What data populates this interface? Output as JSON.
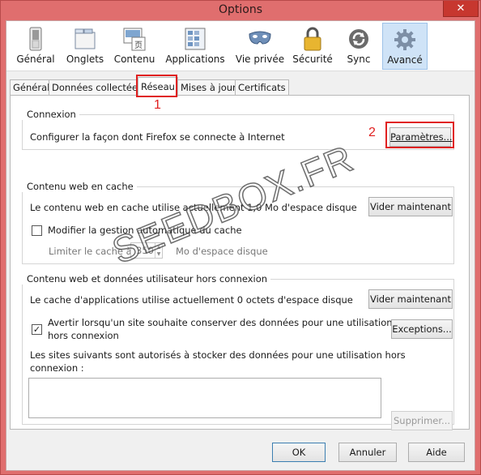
{
  "window": {
    "title": "Options",
    "close_glyph": "✕"
  },
  "panes": [
    {
      "label": "Général",
      "icon": "switch-icon"
    },
    {
      "label": "Onglets",
      "icon": "tabs-icon"
    },
    {
      "label": "Contenu",
      "icon": "content-icon"
    },
    {
      "label": "Applications",
      "icon": "applications-icon"
    },
    {
      "label": "Vie privée",
      "icon": "mask-icon"
    },
    {
      "label": "Sécurité",
      "icon": "padlock-icon"
    },
    {
      "label": "Sync",
      "icon": "sync-icon"
    },
    {
      "label": "Avancé",
      "icon": "gear-icon"
    }
  ],
  "selected_pane": "Avancé",
  "tabs": [
    "Général",
    "Données collectées",
    "Réseau",
    "Mises à jour",
    "Certificats"
  ],
  "active_tab": "Réseau",
  "connexion": {
    "title": "Connexion",
    "description": "Configurer la façon dont Firefox se connecte à Internet",
    "settings_button": "Paramètres..."
  },
  "cache": {
    "title": "Contenu web en cache",
    "usage_text": "Le contenu web en cache utilise actuellement 1,0 Mo d'espace disque",
    "clear_button": "Vider maintenant",
    "override_label": "Modifier la gestion automatique du cache",
    "override_checked": false,
    "limit_label": "Limiter le cache à",
    "limit_value": "350",
    "limit_unit": "Mo d'espace disque"
  },
  "offline": {
    "title": "Contenu web et données utilisateur hors connexion",
    "usage_text": "Le cache d'applications utilise actuellement 0 octets d'espace disque",
    "clear_button": "Vider maintenant",
    "warn_label_line1": "Avertir lorsqu'un site souhaite conserver des données pour une utilisation",
    "warn_label_line2": "hors connexion",
    "warn_checked": true,
    "exceptions_button": "Exceptions...",
    "allowed_label_line1": "Les sites suivants sont autorisés à stocker des données pour une utilisation hors",
    "allowed_label_line2": "connexion :",
    "sites": [],
    "remove_button": "Supprimer..."
  },
  "footer": {
    "ok": "OK",
    "cancel": "Annuler",
    "help": "Aide"
  },
  "annotations": {
    "first": "1",
    "second": "2",
    "color": "#e02020"
  },
  "watermark": "SEEDBOX.FR"
}
